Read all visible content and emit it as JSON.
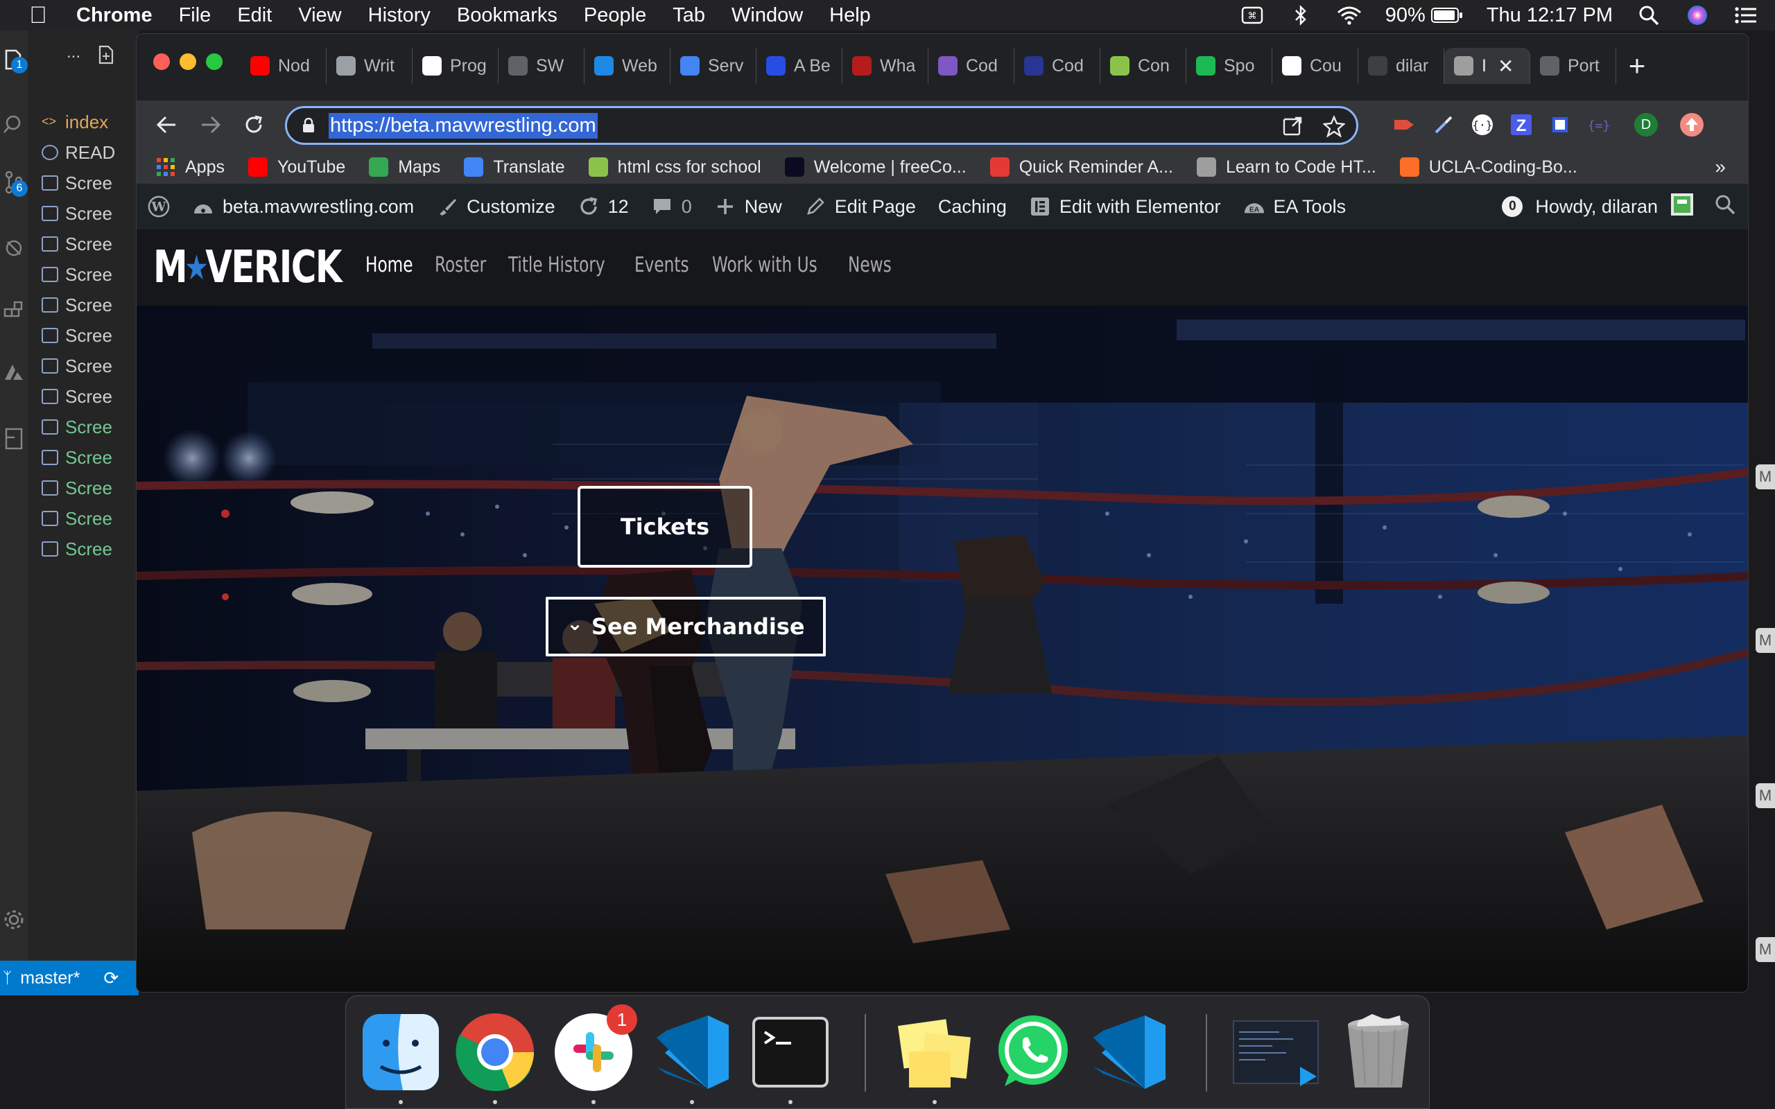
{
  "menubar": {
    "app_name": "Chrome",
    "menus": [
      "File",
      "Edit",
      "View",
      "History",
      "Bookmarks",
      "People",
      "Tab",
      "Window",
      "Help"
    ],
    "battery": "90%",
    "clock": "Thu 12:17 PM"
  },
  "vscode": {
    "activity_badges": {
      "explorer": "1",
      "source_control": "6"
    },
    "explorer_ellipsis": "...",
    "files": [
      {
        "label": "index",
        "color": "orange"
      },
      {
        "label": "READ",
        "color": "white"
      },
      {
        "label": "Scree",
        "color": "white"
      },
      {
        "label": "Scree",
        "color": "white"
      },
      {
        "label": "Scree",
        "color": "white"
      },
      {
        "label": "Scree",
        "color": "white"
      },
      {
        "label": "Scree",
        "color": "white"
      },
      {
        "label": "Scree",
        "color": "white"
      },
      {
        "label": "Scree",
        "color": "white"
      },
      {
        "label": "Scree",
        "color": "white"
      },
      {
        "label": "Scree",
        "color": "green"
      },
      {
        "label": "Scree",
        "color": "green"
      },
      {
        "label": "Scree",
        "color": "green"
      },
      {
        "label": "Scree",
        "color": "green"
      },
      {
        "label": "Scree",
        "color": "green"
      }
    ],
    "branch": "master*"
  },
  "tabs": [
    {
      "label": "Nod",
      "favicon_color": "#ff0000"
    },
    {
      "label": "Writ",
      "favicon_color": "#9aa0a6"
    },
    {
      "label": "Prog",
      "favicon_color": "#ffffff"
    },
    {
      "label": "SW",
      "favicon_color": "#5f6368"
    },
    {
      "label": "Web",
      "favicon_color": "#1e88e5"
    },
    {
      "label": "Serv",
      "favicon_color": "#4285f4"
    },
    {
      "label": "A Be",
      "favicon_color": "#264de4"
    },
    {
      "label": "Wha",
      "favicon_color": "#b71c1c"
    },
    {
      "label": "Cod",
      "favicon_color": "#7e57c2"
    },
    {
      "label": "Cod",
      "favicon_color": "#283593"
    },
    {
      "label": "Con",
      "favicon_color": "#8bc34a"
    },
    {
      "label": "Spo",
      "favicon_color": "#1db954"
    },
    {
      "label": "Cou",
      "favicon_color": "#ffffff"
    },
    {
      "label": "dilar",
      "favicon_color": "#3c4043"
    },
    {
      "label": "I",
      "favicon_color": "#9e9e9e",
      "active": true
    },
    {
      "label": "Port",
      "favicon_color": "#5f6368"
    }
  ],
  "omnibox": {
    "url": "https://beta.mavwrestling.com"
  },
  "profile_initial": "D",
  "bookmarks": {
    "items": [
      {
        "label": "Apps",
        "color": "#ea4335"
      },
      {
        "label": "YouTube",
        "color": "#ff0000"
      },
      {
        "label": "Maps",
        "color": "#34a853"
      },
      {
        "label": "Translate",
        "color": "#4285f4"
      },
      {
        "label": "html css for school",
        "color": "#8bc34a"
      },
      {
        "label": "Welcome | freeCo...",
        "color": "#0a0a23"
      },
      {
        "label": "Quick Reminder A...",
        "color": "#e53935"
      },
      {
        "label": "Learn to Code HT...",
        "color": "#9e9e9e"
      },
      {
        "label": "UCLA-Coding-Bo...",
        "color": "#fc6d26"
      }
    ],
    "more": "»"
  },
  "wp_admin": {
    "site": "beta.mavwrestling.com",
    "customize": "Customize",
    "updates": "12",
    "comments": "0",
    "new": "New",
    "edit_page": "Edit Page",
    "caching": "Caching",
    "elementor": "Edit with Elementor",
    "ea_tools": "EA Tools",
    "notifications": "0",
    "howdy": "Howdy, dilaran"
  },
  "site": {
    "logo_left": "M",
    "logo_right": "VERICK",
    "logo_star": "★",
    "nav": [
      {
        "label": "Home",
        "current": true
      },
      {
        "label": "Roster"
      },
      {
        "label": "Title History"
      },
      {
        "label": "Events"
      },
      {
        "label": "Work with Us"
      },
      {
        "label": "News"
      }
    ],
    "tickets_button": "Tickets",
    "merch_button": "See Merchandise",
    "merch_chevron": "⌄"
  },
  "dock": {
    "apps": [
      "finder",
      "chrome",
      "slack",
      "vscode",
      "terminal",
      "stickies",
      "whatsapp",
      "vscode-insiders",
      "screenshot",
      "trash"
    ],
    "slack_badge": "1"
  },
  "edge_tab_label": "M"
}
